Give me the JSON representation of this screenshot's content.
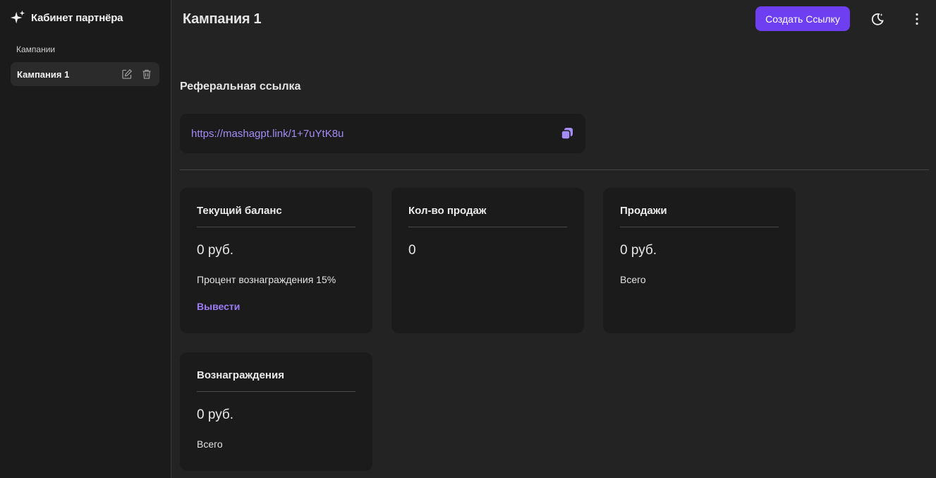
{
  "sidebar": {
    "brand_title": "Кабинет партнёра",
    "section_label": "Кампании",
    "items": [
      {
        "label": "Кампания 1",
        "edit_icon": "edit-icon",
        "delete_icon": "trash-icon"
      }
    ]
  },
  "header": {
    "title": "Кампания 1",
    "create_button": "Создать Ссылку",
    "theme_icon": "moon-icon",
    "menu_icon": "more-vertical-icon"
  },
  "referral": {
    "heading": "Реферальная ссылка",
    "link": "https://mashagpt.link/1+7uYtK8u",
    "copy_icon": "copy-icon"
  },
  "cards": {
    "balance": {
      "title": "Текущий баланс",
      "value": "0 руб.",
      "text": "Процент вознаграждения 15%",
      "action": "Вывести"
    },
    "sales_count": {
      "title": "Кол-во продаж",
      "value": "0"
    },
    "sales": {
      "title": "Продажи",
      "value": "0 руб.",
      "text": "Всего"
    },
    "rewards": {
      "title": "Вознаграждения",
      "value": "0 руб.",
      "text": "Всего"
    }
  },
  "colors": {
    "accent": "#6e3ff0",
    "link": "#a48bf6",
    "background": "#232323",
    "surface": "#1b1b1b"
  }
}
